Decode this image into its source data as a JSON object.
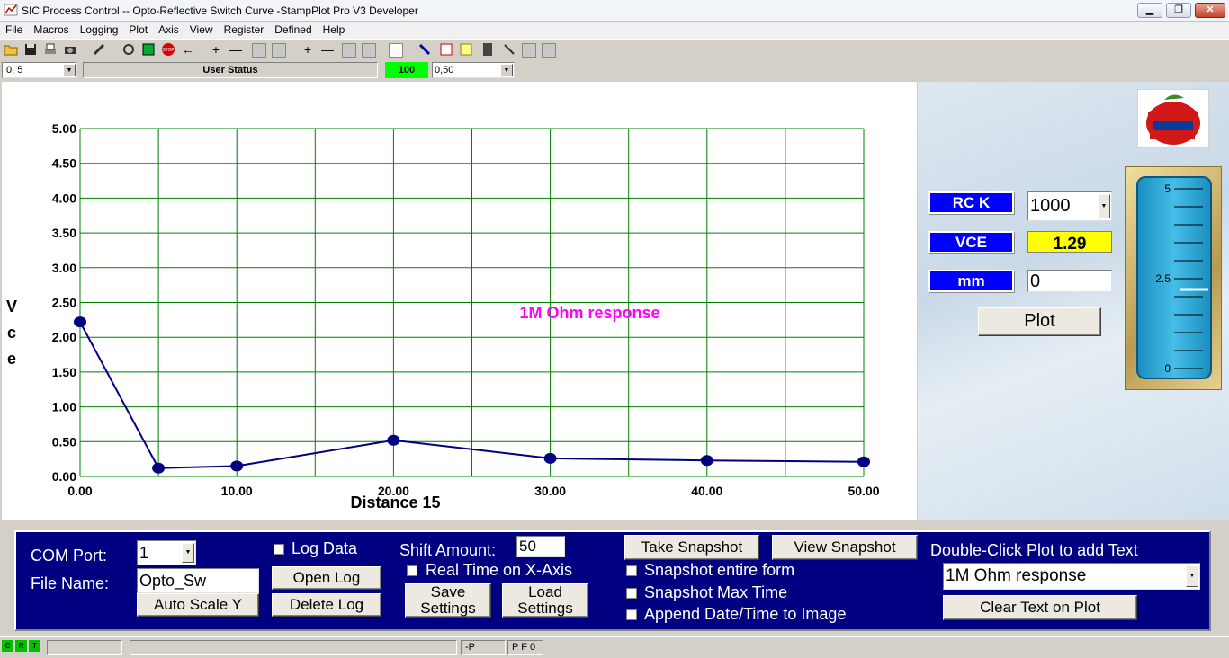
{
  "window": {
    "title": "SIC Process Control -- Opto-Reflective Switch Curve -StampPlot Pro V3 Developer",
    "controls": {
      "minimize": "▁",
      "restore": "❐",
      "close": "✕"
    }
  },
  "menu": [
    "File",
    "Macros",
    "Logging",
    "Plot",
    "Axis",
    "View",
    "Register",
    "Defined",
    "Help"
  ],
  "toolbar_icons": [
    "open-folder-icon",
    "save-disk-icon",
    "print-icon",
    "camera-icon",
    "pencil-tool-icon",
    "connect-icon",
    "monitor-icon",
    "stop-icon",
    "arrow-left-icon",
    "zoom-in-plus-icon",
    "zoom-out-minus-icon",
    "scroll-left-icon",
    "scroll-right-icon",
    "zoom-in-plus-icon",
    "zoom-out-minus-icon",
    "page-left-icon",
    "page-right-icon",
    "text-box-icon",
    "pen-icon",
    "grid-icon",
    "note-icon",
    "calculator-icon",
    "probe-icon",
    "resize-icon",
    "wrench-icon"
  ],
  "status_row": {
    "left_combo": "0, 5",
    "user_status": "User Status",
    "counter": "100",
    "right_combo": "0,50"
  },
  "chart_data": {
    "type": "line",
    "title": "",
    "xlabel": "Distance 15",
    "ylabel": "V c e",
    "ylabel_chars": [
      "V",
      "c",
      "e"
    ],
    "xlim": [
      0,
      50
    ],
    "ylim": [
      0,
      5
    ],
    "x_ticks": [
      "0.00",
      "10.00",
      "20.00",
      "30.00",
      "40.00",
      "50.00"
    ],
    "y_ticks": [
      "0.00",
      "0.50",
      "1.00",
      "1.50",
      "2.00",
      "2.50",
      "3.00",
      "3.50",
      "4.00",
      "4.50",
      "5.00"
    ],
    "grid": true,
    "grid_color": "#008000",
    "series": [
      {
        "color": "#000080",
        "x": [
          0,
          5,
          10,
          20,
          30,
          40,
          50
        ],
        "y": [
          2.22,
          0.12,
          0.15,
          0.52,
          0.26,
          0.23,
          0.21
        ]
      }
    ],
    "annotation": {
      "text": "1M Ohm response",
      "x": 32,
      "y": 2.35,
      "color": "#ff00ff"
    }
  },
  "right_panel": {
    "logo_alt": "Stamps in Class",
    "rc_label": "RC K",
    "rc_value": "1000",
    "vce_label": "VCE",
    "vce_value": "1.29",
    "mm_label": "mm",
    "mm_value": "0",
    "plot_button": "Plot",
    "gauge": {
      "ticks": [
        "5",
        "2.5",
        "0"
      ],
      "max": 5,
      "min": 0,
      "value": 2.2
    }
  },
  "bottom": {
    "com_port_label": "COM Port:",
    "com_port_value": "1",
    "file_name_label": "File Name:",
    "file_name_value": "Opto_Sw",
    "auto_scale_button": "Auto Scale Y",
    "log_data_label": "Log Data",
    "open_log_button": "Open Log",
    "delete_log_button": "Delete Log",
    "shift_amount_label": "Shift Amount:",
    "shift_amount_value": "50",
    "real_time_label": "Real Time on X-Axis",
    "save_settings_button": [
      "Save",
      "Settings"
    ],
    "load_settings_button": [
      "Load",
      "Settings"
    ],
    "take_snapshot_button": "Take Snapshot",
    "view_snapshot_button": "View Snapshot",
    "snapshot_entire_label": "Snapshot entire form",
    "snapshot_max_label": "Snapshot Max Time",
    "append_date_label": "Append Date/Time to Image",
    "double_click_label": "Double-Click Plot to add Text",
    "text_combo_value": "1M Ohm response",
    "clear_text_button": "Clear Text on Plot"
  },
  "statusbar": {
    "leds": [
      "C",
      "R",
      "T"
    ],
    "field_p": "-P",
    "field_pf": "P F 0"
  }
}
